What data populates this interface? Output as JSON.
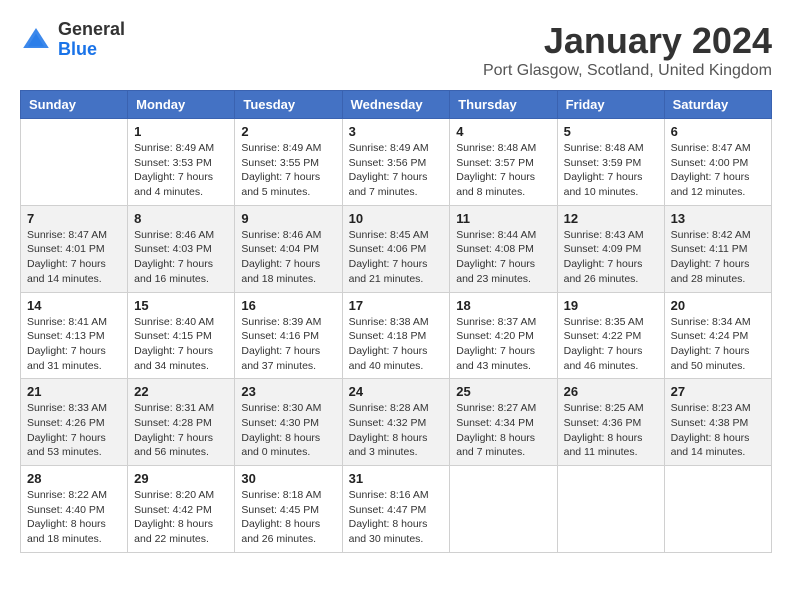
{
  "header": {
    "logo": {
      "general": "General",
      "blue": "Blue"
    },
    "title": "January 2024",
    "location": "Port Glasgow, Scotland, United Kingdom"
  },
  "days_of_week": [
    "Sunday",
    "Monday",
    "Tuesday",
    "Wednesday",
    "Thursday",
    "Friday",
    "Saturday"
  ],
  "weeks": [
    [
      {
        "day": "",
        "info": ""
      },
      {
        "day": "1",
        "info": "Sunrise: 8:49 AM\nSunset: 3:53 PM\nDaylight: 7 hours\nand 4 minutes."
      },
      {
        "day": "2",
        "info": "Sunrise: 8:49 AM\nSunset: 3:55 PM\nDaylight: 7 hours\nand 5 minutes."
      },
      {
        "day": "3",
        "info": "Sunrise: 8:49 AM\nSunset: 3:56 PM\nDaylight: 7 hours\nand 7 minutes."
      },
      {
        "day": "4",
        "info": "Sunrise: 8:48 AM\nSunset: 3:57 PM\nDaylight: 7 hours\nand 8 minutes."
      },
      {
        "day": "5",
        "info": "Sunrise: 8:48 AM\nSunset: 3:59 PM\nDaylight: 7 hours\nand 10 minutes."
      },
      {
        "day": "6",
        "info": "Sunrise: 8:47 AM\nSunset: 4:00 PM\nDaylight: 7 hours\nand 12 minutes."
      }
    ],
    [
      {
        "day": "7",
        "info": "Sunrise: 8:47 AM\nSunset: 4:01 PM\nDaylight: 7 hours\nand 14 minutes."
      },
      {
        "day": "8",
        "info": "Sunrise: 8:46 AM\nSunset: 4:03 PM\nDaylight: 7 hours\nand 16 minutes."
      },
      {
        "day": "9",
        "info": "Sunrise: 8:46 AM\nSunset: 4:04 PM\nDaylight: 7 hours\nand 18 minutes."
      },
      {
        "day": "10",
        "info": "Sunrise: 8:45 AM\nSunset: 4:06 PM\nDaylight: 7 hours\nand 21 minutes."
      },
      {
        "day": "11",
        "info": "Sunrise: 8:44 AM\nSunset: 4:08 PM\nDaylight: 7 hours\nand 23 minutes."
      },
      {
        "day": "12",
        "info": "Sunrise: 8:43 AM\nSunset: 4:09 PM\nDaylight: 7 hours\nand 26 minutes."
      },
      {
        "day": "13",
        "info": "Sunrise: 8:42 AM\nSunset: 4:11 PM\nDaylight: 7 hours\nand 28 minutes."
      }
    ],
    [
      {
        "day": "14",
        "info": "Sunrise: 8:41 AM\nSunset: 4:13 PM\nDaylight: 7 hours\nand 31 minutes."
      },
      {
        "day": "15",
        "info": "Sunrise: 8:40 AM\nSunset: 4:15 PM\nDaylight: 7 hours\nand 34 minutes."
      },
      {
        "day": "16",
        "info": "Sunrise: 8:39 AM\nSunset: 4:16 PM\nDaylight: 7 hours\nand 37 minutes."
      },
      {
        "day": "17",
        "info": "Sunrise: 8:38 AM\nSunset: 4:18 PM\nDaylight: 7 hours\nand 40 minutes."
      },
      {
        "day": "18",
        "info": "Sunrise: 8:37 AM\nSunset: 4:20 PM\nDaylight: 7 hours\nand 43 minutes."
      },
      {
        "day": "19",
        "info": "Sunrise: 8:35 AM\nSunset: 4:22 PM\nDaylight: 7 hours\nand 46 minutes."
      },
      {
        "day": "20",
        "info": "Sunrise: 8:34 AM\nSunset: 4:24 PM\nDaylight: 7 hours\nand 50 minutes."
      }
    ],
    [
      {
        "day": "21",
        "info": "Sunrise: 8:33 AM\nSunset: 4:26 PM\nDaylight: 7 hours\nand 53 minutes."
      },
      {
        "day": "22",
        "info": "Sunrise: 8:31 AM\nSunset: 4:28 PM\nDaylight: 7 hours\nand 56 minutes."
      },
      {
        "day": "23",
        "info": "Sunrise: 8:30 AM\nSunset: 4:30 PM\nDaylight: 8 hours\nand 0 minutes."
      },
      {
        "day": "24",
        "info": "Sunrise: 8:28 AM\nSunset: 4:32 PM\nDaylight: 8 hours\nand 3 minutes."
      },
      {
        "day": "25",
        "info": "Sunrise: 8:27 AM\nSunset: 4:34 PM\nDaylight: 8 hours\nand 7 minutes."
      },
      {
        "day": "26",
        "info": "Sunrise: 8:25 AM\nSunset: 4:36 PM\nDaylight: 8 hours\nand 11 minutes."
      },
      {
        "day": "27",
        "info": "Sunrise: 8:23 AM\nSunset: 4:38 PM\nDaylight: 8 hours\nand 14 minutes."
      }
    ],
    [
      {
        "day": "28",
        "info": "Sunrise: 8:22 AM\nSunset: 4:40 PM\nDaylight: 8 hours\nand 18 minutes."
      },
      {
        "day": "29",
        "info": "Sunrise: 8:20 AM\nSunset: 4:42 PM\nDaylight: 8 hours\nand 22 minutes."
      },
      {
        "day": "30",
        "info": "Sunrise: 8:18 AM\nSunset: 4:45 PM\nDaylight: 8 hours\nand 26 minutes."
      },
      {
        "day": "31",
        "info": "Sunrise: 8:16 AM\nSunset: 4:47 PM\nDaylight: 8 hours\nand 30 minutes."
      },
      {
        "day": "",
        "info": ""
      },
      {
        "day": "",
        "info": ""
      },
      {
        "day": "",
        "info": ""
      }
    ]
  ]
}
